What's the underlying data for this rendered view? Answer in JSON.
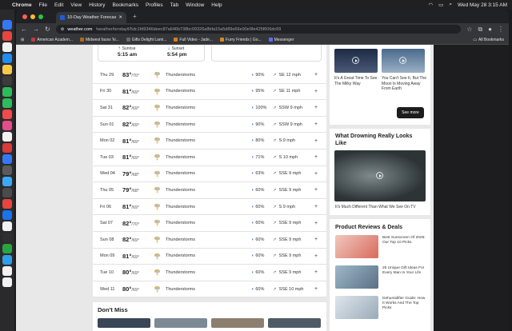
{
  "menubar": {
    "app": "Chrome",
    "items": [
      "File",
      "Edit",
      "View",
      "History",
      "Bookmarks",
      "Profiles",
      "Tab",
      "Window",
      "Help"
    ],
    "clock": "Wed May 28  3:15 AM"
  },
  "browser": {
    "tab_title": "10-Day Weather Forecast for",
    "url_host": "weather.com",
    "url_path": "/weather/tenday/l/5dc1fd9346deec87a646b738bc09326a8bfa15a5d89e66e90e9fe425f606dc69",
    "bookmarks": [
      {
        "label": "American Academ...",
        "color": "#c23b3b"
      },
      {
        "label": "Midwest faces 'ki...",
        "color": "#b8651b"
      },
      {
        "label": "Gifts Delight Lami...",
        "color": "#6a6a6a"
      },
      {
        "label": "Full Video - Jade...",
        "color": "#e07b1b"
      },
      {
        "label": "Furry Friends | Go...",
        "color": "#d88a1b"
      },
      {
        "label": "Messenger",
        "color": "#5b6ef5"
      }
    ],
    "all_bookmarks": "All Bookmarks"
  },
  "sun": {
    "sunrise_label": "Sunrise",
    "sunrise": "5:15 am",
    "sunset_label": "Sunset",
    "sunset": "5:54 pm"
  },
  "forecast": [
    {
      "day": "Thu 29",
      "hi": "83°",
      "lo": "/70°",
      "cond": "Thunderstorms",
      "precip": "90%",
      "wind": "SE 12 mph"
    },
    {
      "day": "Fri 30",
      "hi": "81°",
      "lo": "/69°",
      "cond": "Thunderstorms",
      "precip": "95%",
      "wind": "SE 11 mph"
    },
    {
      "day": "Sat 31",
      "hi": "82°",
      "lo": "/69°",
      "cond": "Thunderstorms",
      "precip": "100%",
      "wind": "SSW 9 mph"
    },
    {
      "day": "Sun 01",
      "hi": "82°",
      "lo": "/69°",
      "cond": "Thunderstorms",
      "precip": "90%",
      "wind": "SSW 9 mph"
    },
    {
      "day": "Mon 02",
      "hi": "81°",
      "lo": "/69°",
      "cond": "Thunderstorms",
      "precip": "80%",
      "wind": "S 9 mph"
    },
    {
      "day": "Tue 03",
      "hi": "81°",
      "lo": "/69°",
      "cond": "Thunderstorms",
      "precip": "71%",
      "wind": "S 10 mph"
    },
    {
      "day": "Wed 04",
      "hi": "79°",
      "lo": "/68°",
      "cond": "Thunderstorms",
      "precip": "63%",
      "wind": "SSE 9 mph"
    },
    {
      "day": "Thu 05",
      "hi": "79°",
      "lo": "/68°",
      "cond": "Thunderstorms",
      "precip": "60%",
      "wind": "SSE 9 mph"
    },
    {
      "day": "Fri 06",
      "hi": "81°",
      "lo": "/69°",
      "cond": "Thunderstorms",
      "precip": "60%",
      "wind": "S 9 mph"
    },
    {
      "day": "Sat 07",
      "hi": "82°",
      "lo": "/70°",
      "cond": "Thunderstorms",
      "precip": "60%",
      "wind": "SSE 9 mph"
    },
    {
      "day": "Sun 08",
      "hi": "82°",
      "lo": "/69°",
      "cond": "Thunderstorms",
      "precip": "60%",
      "wind": "SSE 9 mph"
    },
    {
      "day": "Mon 09",
      "hi": "81°",
      "lo": "/69°",
      "cond": "Thunderstorms",
      "precip": "60%",
      "wind": "SSE 9 mph"
    },
    {
      "day": "Tue 10",
      "hi": "80°",
      "lo": "/69°",
      "cond": "Thunderstorms",
      "precip": "60%",
      "wind": "SSE 9 mph"
    },
    {
      "day": "Wed 11",
      "hi": "80°",
      "lo": "/69°",
      "cond": "Thunderstorms",
      "precip": "60%",
      "wind": "SSE 10 mph"
    }
  ],
  "dont_miss": {
    "title": "Don't Miss"
  },
  "sidebar": {
    "video1_caption": "It's A Great Time To See The Milky Way",
    "video2_caption": "You Can't See It, But The Moon Is Moving Away From Earth",
    "see_more": "See more",
    "drowning_title": "What Drowning Really Looks Like",
    "drowning_caption": "It's Much Different Than What We See On TV",
    "deals_title": "Product Reviews & Deals",
    "deals": [
      {
        "text": "Best Sunscreen Of 2025: Our Top 10 Picks"
      },
      {
        "text": "25 Unique Gift Ideas For Every Man In Your Life"
      },
      {
        "text": "Dehumidifier Guide: How It Works And The Top Picks"
      }
    ]
  },
  "colors": {
    "accent": "#3a6fd8",
    "page_bg": "#e8e8e8"
  }
}
